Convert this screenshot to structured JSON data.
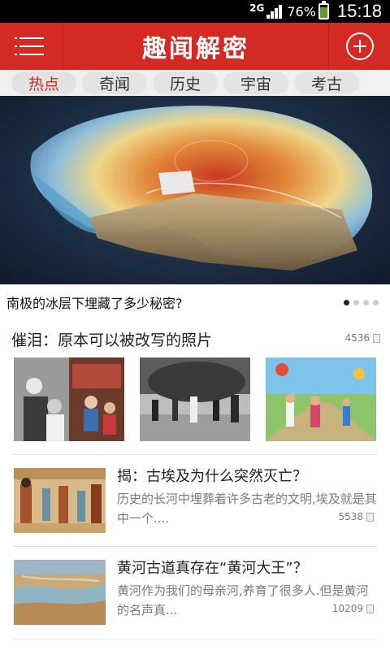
{
  "status_bar": {
    "network": "2G",
    "battery": "76%",
    "time": "15:18"
  },
  "header": {
    "title": "趣闻解密",
    "menu_icon": "menu-icon",
    "add_icon": "plus-circle-icon"
  },
  "tabs": [
    {
      "label": "热点",
      "active": true
    },
    {
      "label": "奇闻",
      "active": false
    },
    {
      "label": "历史",
      "active": false
    },
    {
      "label": "宇宙",
      "active": false
    },
    {
      "label": "考古",
      "active": false
    }
  ],
  "hero": {
    "caption": "南极的冰层下埋藏了多少秘密?",
    "page_index": 1,
    "page_count": 4
  },
  "gallery": {
    "title": "催泪：原本可以被改写的照片",
    "count": "4536"
  },
  "articles": [
    {
      "title": "揭：古埃及为什么突然灭亡？",
      "summary": "历史的长河中埋葬着许多古老的文明,埃及就是其中一个....",
      "count": "5538"
    },
    {
      "title": "黄河古道真存在“黄河大王”？",
      "summary": "黄河作为我们的母亲河,养育了很多人.但是黄河的名声真...",
      "count": "10209"
    }
  ],
  "colors": {
    "brand_red": "#d42a24",
    "status_bar": "#000000"
  }
}
